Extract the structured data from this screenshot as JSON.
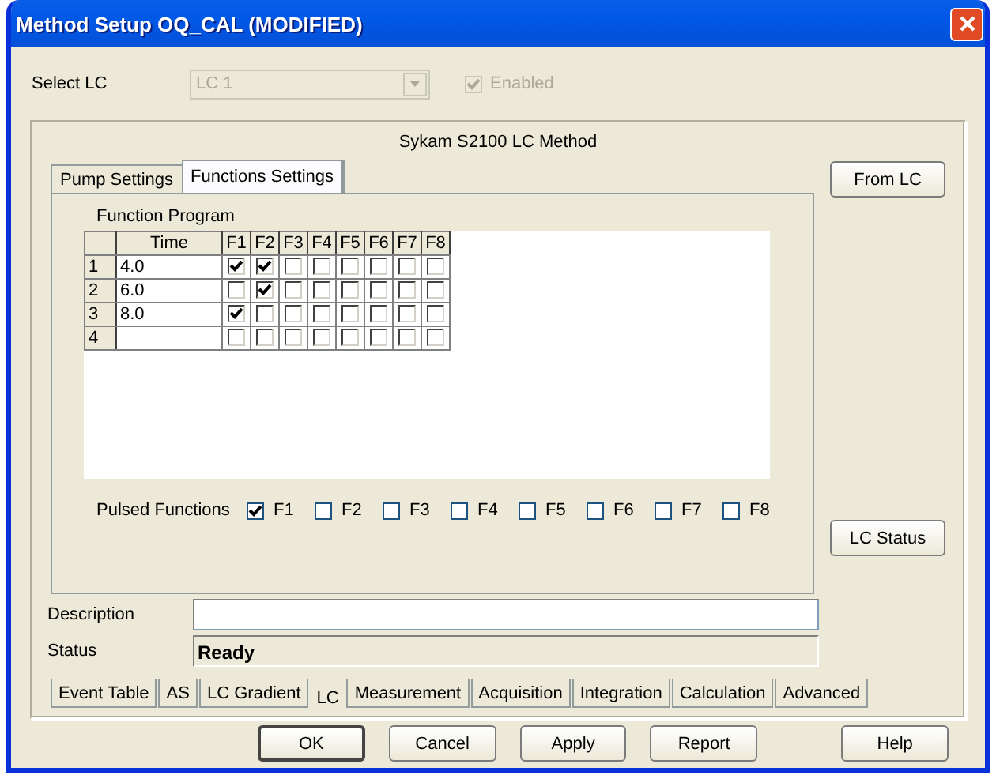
{
  "window": {
    "title": "Method Setup OQ_CAL (MODIFIED)"
  },
  "select_lc": {
    "label": "Select LC",
    "value": "LC 1",
    "disabled": true
  },
  "enabled": {
    "label": "Enabled",
    "checked": true,
    "disabled": true
  },
  "method_title": "Sykam S2100 LC Method",
  "tabs": [
    {
      "label": "Pump Settings",
      "selected": false
    },
    {
      "label": "Functions Settings",
      "selected": true
    }
  ],
  "function_program": {
    "label": "Function Program",
    "time_header": "Time",
    "flag_headers": [
      "F1",
      "F2",
      "F3",
      "F4",
      "F5",
      "F6",
      "F7",
      "F8"
    ],
    "rows": [
      {
        "number": "1",
        "time": "4.0",
        "flags": [
          true,
          true,
          false,
          false,
          false,
          false,
          false,
          false
        ]
      },
      {
        "number": "2",
        "time": "6.0",
        "flags": [
          false,
          true,
          false,
          false,
          false,
          false,
          false,
          false
        ]
      },
      {
        "number": "3",
        "time": "8.0",
        "flags": [
          true,
          false,
          false,
          false,
          false,
          false,
          false,
          false
        ]
      },
      {
        "number": "4",
        "flags": [
          false,
          false,
          false,
          false,
          false,
          false,
          false,
          false
        ]
      }
    ]
  },
  "pulsed_functions": {
    "label": "Pulsed Functions",
    "items": [
      {
        "label": "F1",
        "checked": true
      },
      {
        "label": "F2",
        "checked": false
      },
      {
        "label": "F3",
        "checked": false
      },
      {
        "label": "F4",
        "checked": false
      },
      {
        "label": "F5",
        "checked": false
      },
      {
        "label": "F6",
        "checked": false
      },
      {
        "label": "F7",
        "checked": false
      },
      {
        "label": "F8",
        "checked": false
      }
    ]
  },
  "side_buttons": [
    "From LC",
    "LC Status"
  ],
  "description": {
    "label": "Description"
  },
  "status": {
    "label": "Status",
    "value": "Ready"
  },
  "bottom_tabs": [
    {
      "label": "Event Table",
      "selected": false
    },
    {
      "label": "AS",
      "selected": false
    },
    {
      "label": "LC Gradient",
      "selected": false
    },
    {
      "label": "LC",
      "selected": true
    },
    {
      "label": "Measurement",
      "selected": false
    },
    {
      "label": "Acquisition",
      "selected": false
    },
    {
      "label": "Integration",
      "selected": false
    },
    {
      "label": "Calculation",
      "selected": false
    },
    {
      "label": "Advanced",
      "selected": false
    }
  ],
  "buttons": [
    {
      "label": "OK",
      "default": true
    },
    {
      "label": "Cancel",
      "default": false
    },
    {
      "label": "Apply",
      "default": false
    },
    {
      "label": "Report",
      "default": false
    },
    {
      "label": "Help",
      "default": false
    }
  ]
}
